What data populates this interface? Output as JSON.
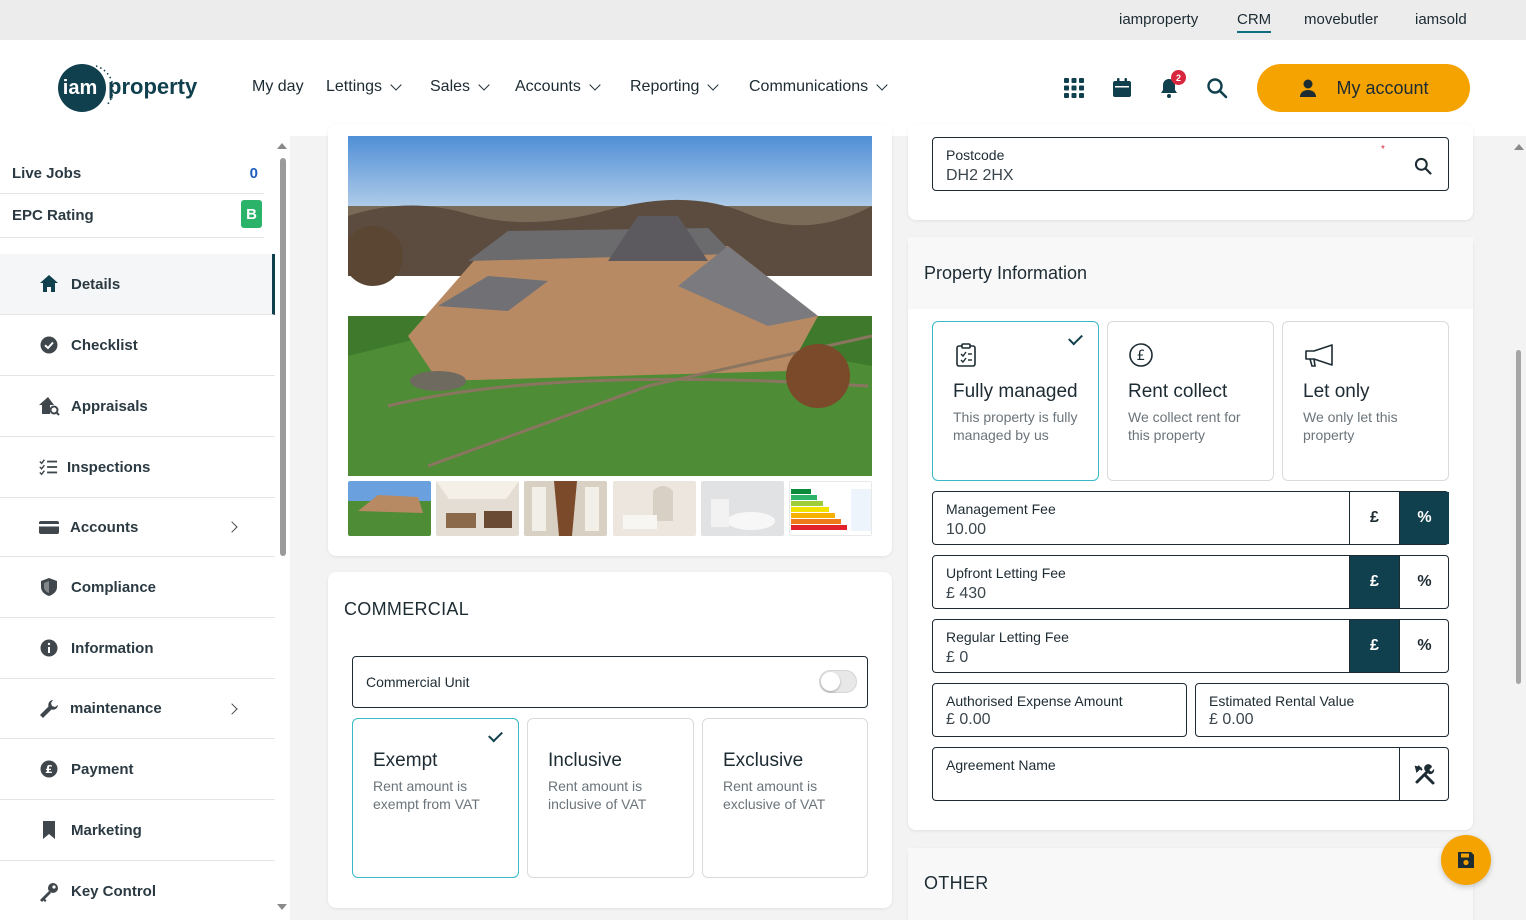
{
  "topbar": {
    "links": [
      {
        "label": "iamproperty",
        "active": false
      },
      {
        "label": "CRM",
        "active": true
      },
      {
        "label": "movebutler",
        "active": false
      },
      {
        "label": "iamsold",
        "active": false
      }
    ]
  },
  "header": {
    "logo": {
      "mark": "iam",
      "word": "property"
    },
    "nav": [
      {
        "label": "My day",
        "dropdown": false
      },
      {
        "label": "Lettings",
        "dropdown": true
      },
      {
        "label": "Sales",
        "dropdown": true
      },
      {
        "label": "Accounts",
        "dropdown": true
      },
      {
        "label": "Reporting",
        "dropdown": true
      },
      {
        "label": "Communications",
        "dropdown": true
      }
    ],
    "icons": [
      "apps-grid-icon",
      "calendar-icon",
      "bell-icon",
      "search-icon"
    ],
    "notification_count": "2",
    "account_label": "My account"
  },
  "sidebar": {
    "live_jobs": {
      "label": "Live Jobs",
      "value": "0"
    },
    "epc": {
      "label": "EPC Rating",
      "value": "B"
    },
    "items": [
      {
        "label": "Details",
        "icon": "home-icon",
        "active": true,
        "submenu": false
      },
      {
        "label": "Checklist",
        "icon": "check-circle-icon",
        "active": false,
        "submenu": false
      },
      {
        "label": "Appraisals",
        "icon": "house-search-icon",
        "active": false,
        "submenu": false
      },
      {
        "label": "Inspections",
        "icon": "list-check-icon",
        "active": false,
        "submenu": false
      },
      {
        "label": "Accounts",
        "icon": "credit-card-icon",
        "active": false,
        "submenu": true
      },
      {
        "label": "Compliance",
        "icon": "shield-icon",
        "active": false,
        "submenu": false
      },
      {
        "label": "Information",
        "icon": "info-icon",
        "active": false,
        "submenu": false
      },
      {
        "label": "maintenance",
        "icon": "wrench-icon",
        "active": false,
        "submenu": true
      },
      {
        "label": "Payment",
        "icon": "pound-coin-icon",
        "active": false,
        "submenu": false
      },
      {
        "label": "Marketing",
        "icon": "bookmark-icon",
        "active": false,
        "submenu": false
      },
      {
        "label": "Key Control",
        "icon": "key-icon",
        "active": false,
        "submenu": false
      }
    ]
  },
  "colors": {
    "brand_dark": "#103f4d",
    "accent": "#f5a300",
    "selected_border": "#39b8c7",
    "epc_green": "#2bb36a",
    "badge_red": "#d7263d"
  },
  "commercial": {
    "title": "COMMERCIAL",
    "toggle_label": "Commercial Unit",
    "toggle_on": false,
    "options": [
      {
        "title": "Exempt",
        "desc": "Rent amount is exempt from VAT",
        "selected": true
      },
      {
        "title": "Inclusive",
        "desc": "Rent amount is inclusive of VAT",
        "selected": false
      },
      {
        "title": "Exclusive",
        "desc": "Rent amount is exclusive of VAT",
        "selected": false
      }
    ]
  },
  "postcode": {
    "label": "Postcode",
    "value": "DH2 2HX",
    "required_mark": "*"
  },
  "property_info": {
    "title": "Property Information",
    "options": [
      {
        "title": "Fully managed",
        "desc": "This property is fully managed by us",
        "icon": "clipboard-check-icon",
        "selected": true
      },
      {
        "title": "Rent collect",
        "desc": "We collect rent for this property",
        "icon": "pound-circle-icon",
        "selected": false
      },
      {
        "title": "Let only",
        "desc": "We only let this property",
        "icon": "megaphone-icon",
        "selected": false
      }
    ],
    "fields": {
      "management_fee": {
        "label": "Management Fee",
        "value": "10.00",
        "unit": "%"
      },
      "upfront_letting_fee": {
        "label": "Upfront Letting Fee",
        "value": "£ 430",
        "unit": "£"
      },
      "regular_letting_fee": {
        "label": "Regular Letting Fee",
        "value": "£ 0",
        "unit": "£"
      },
      "authorised_expense": {
        "label": "Authorised Expense Amount",
        "value": "£ 0.00"
      },
      "estimated_rental": {
        "label": "Estimated Rental Value",
        "value": "£ 0.00"
      },
      "agreement_name": {
        "label": "Agreement Name",
        "value": ""
      }
    },
    "segment_labels": {
      "pound": "£",
      "percent": "%"
    }
  },
  "other": {
    "title": "OTHER"
  }
}
